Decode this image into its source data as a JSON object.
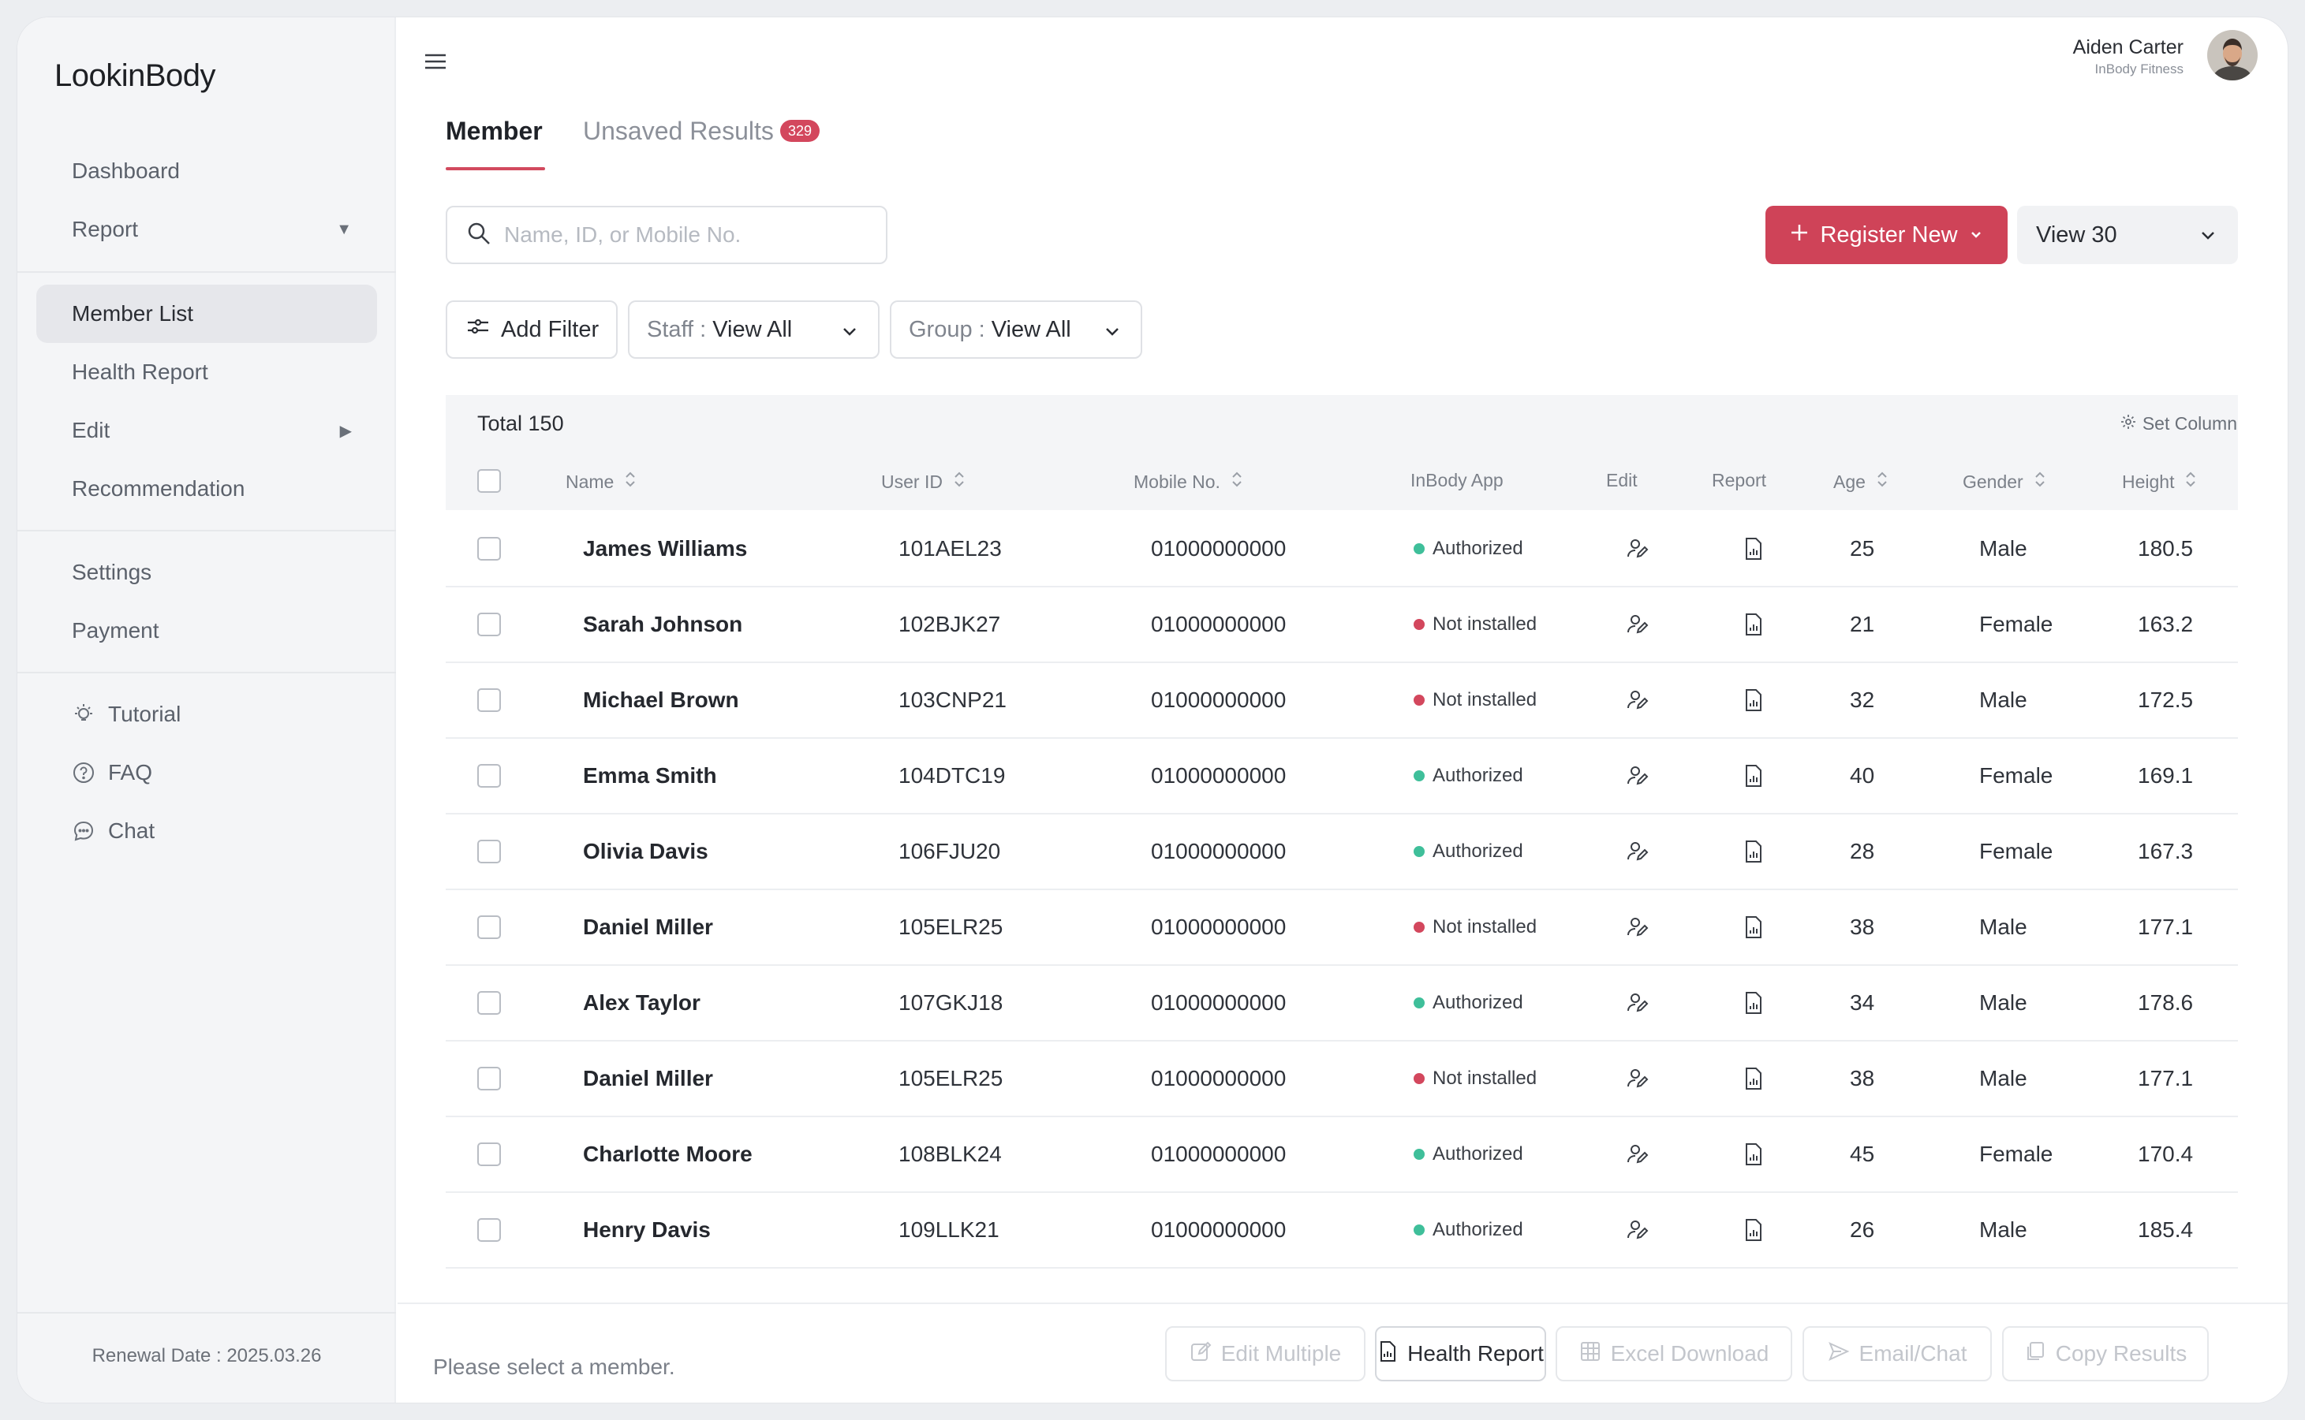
{
  "app": {
    "logo": "LookinBody"
  },
  "sidebar": {
    "items": [
      {
        "label": "Dashboard"
      },
      {
        "label": "Report"
      },
      {
        "label": "Member List"
      },
      {
        "label": "Health Report"
      },
      {
        "label": "Edit"
      },
      {
        "label": "Recommendation"
      },
      {
        "label": "Settings"
      },
      {
        "label": "Payment"
      },
      {
        "label": "Tutorial"
      },
      {
        "label": "FAQ"
      },
      {
        "label": "Chat"
      }
    ],
    "renewal": "Renewal Date : 2025.03.26"
  },
  "user": {
    "name": "Aiden Carter",
    "org": "InBody Fitness"
  },
  "tabs": {
    "member": "Member",
    "unsaved": "Unsaved Results",
    "unsaved_count": "329"
  },
  "search": {
    "placeholder": "Name, ID, or Mobile No."
  },
  "actions": {
    "register": "Register New",
    "view": "View 30"
  },
  "filters": {
    "add_filter": "Add Filter",
    "staff_label": "Staff :",
    "staff_value": "View All",
    "group_label": "Group :",
    "group_value": "View All"
  },
  "table": {
    "total": "Total 150",
    "set_column": "Set Column",
    "columns": {
      "name": "Name",
      "user_id": "User ID",
      "mobile": "Mobile No.",
      "app": "InBody App",
      "edit": "Edit",
      "report": "Report",
      "age": "Age",
      "gender": "Gender",
      "height": "Height"
    },
    "rows": [
      {
        "name": "James Williams",
        "id": "101AEL23",
        "mobile": "01000000000",
        "app": "Authorized",
        "age": "25",
        "gender": "Male",
        "height": "180.5"
      },
      {
        "name": "Sarah Johnson",
        "id": "102BJK27",
        "mobile": "01000000000",
        "app": "Not installed",
        "age": "21",
        "gender": "Female",
        "height": "163.2"
      },
      {
        "name": "Michael Brown",
        "id": "103CNP21",
        "mobile": "01000000000",
        "app": "Not installed",
        "age": "32",
        "gender": "Male",
        "height": "172.5"
      },
      {
        "name": "Emma Smith",
        "id": "104DTC19",
        "mobile": "01000000000",
        "app": "Authorized",
        "age": "40",
        "gender": "Female",
        "height": "169.1"
      },
      {
        "name": "Olivia Davis",
        "id": "106FJU20",
        "mobile": "01000000000",
        "app": "Authorized",
        "age": "28",
        "gender": "Female",
        "height": "167.3"
      },
      {
        "name": "Daniel Miller",
        "id": "105ELR25",
        "mobile": "01000000000",
        "app": "Not installed",
        "age": "38",
        "gender": "Male",
        "height": "177.1"
      },
      {
        "name": "Alex Taylor",
        "id": "107GKJ18",
        "mobile": "01000000000",
        "app": "Authorized",
        "age": "34",
        "gender": "Male",
        "height": "178.6"
      },
      {
        "name": "Daniel Miller",
        "id": "105ELR25",
        "mobile": "01000000000",
        "app": "Not installed",
        "age": "38",
        "gender": "Male",
        "height": "177.1"
      },
      {
        "name": "Charlotte Moore",
        "id": "108BLK24",
        "mobile": "01000000000",
        "app": "Authorized",
        "age": "45",
        "gender": "Female",
        "height": "170.4"
      },
      {
        "name": "Henry Davis",
        "id": "109LLK21",
        "mobile": "01000000000",
        "app": "Authorized",
        "age": "26",
        "gender": "Male",
        "height": "185.4"
      }
    ]
  },
  "footer": {
    "hint": "Please select a member.",
    "edit_multiple": "Edit Multiple",
    "health_report": "Health Report",
    "excel": "Excel Download",
    "email": "Email/Chat",
    "copy": "Copy Results"
  },
  "colors": {
    "accent": "#cf4358",
    "authorized": "#3fbf9a",
    "not_installed": "#d3475d"
  }
}
